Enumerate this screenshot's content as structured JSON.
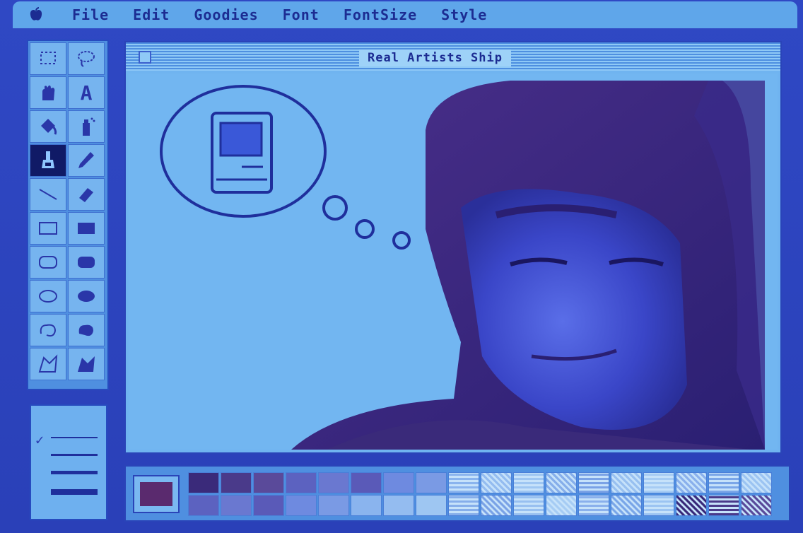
{
  "menubar": {
    "apple_icon": "apple-icon",
    "items": [
      "File",
      "Edit",
      "Goodies",
      "Font",
      "FontSize",
      "Style"
    ]
  },
  "window": {
    "title": "Real Artists Ship"
  },
  "tools": [
    {
      "name": "selection-icon",
      "selected": false
    },
    {
      "name": "lasso-icon",
      "selected": false
    },
    {
      "name": "hand-icon",
      "selected": false
    },
    {
      "name": "text-tool-icon",
      "glyph": "A",
      "selected": false
    },
    {
      "name": "paint-bucket-icon",
      "selected": false
    },
    {
      "name": "spray-can-icon",
      "selected": false
    },
    {
      "name": "paintbrush-icon",
      "selected": true
    },
    {
      "name": "pencil-icon",
      "selected": false
    },
    {
      "name": "line-icon",
      "selected": false
    },
    {
      "name": "eraser-icon",
      "selected": false
    },
    {
      "name": "rectangle-icon",
      "selected": false
    },
    {
      "name": "filled-rectangle-icon",
      "selected": false
    },
    {
      "name": "rounded-rectangle-icon",
      "selected": false
    },
    {
      "name": "filled-rounded-rectangle-icon",
      "selected": false
    },
    {
      "name": "oval-icon",
      "selected": false
    },
    {
      "name": "filled-oval-icon",
      "selected": false
    },
    {
      "name": "freeform-icon",
      "selected": false
    },
    {
      "name": "filled-freeform-icon",
      "selected": false
    },
    {
      "name": "polygon-icon",
      "selected": false
    },
    {
      "name": "filled-polygon-icon",
      "selected": false
    }
  ],
  "line_widths": {
    "selected_index": 0,
    "check_glyph": "✓"
  },
  "colors": {
    "screen": "#2a40b8",
    "canvas": "#72b6f1",
    "ink": "#1f2f9c"
  }
}
